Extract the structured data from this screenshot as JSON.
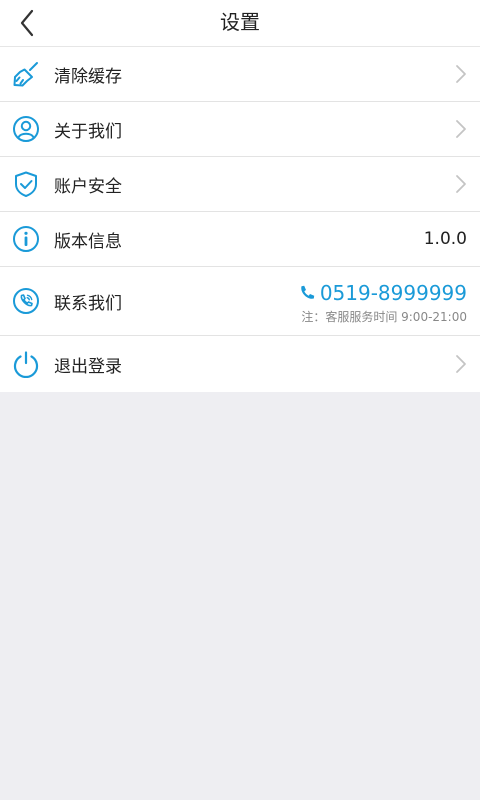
{
  "header": {
    "title": "设置",
    "back_icon": "chevron-left-icon"
  },
  "settings": {
    "clear_cache": {
      "label": "清除缓存",
      "icon": "broom-icon"
    },
    "about_us": {
      "label": "关于我们",
      "icon": "user-icon"
    },
    "account_security": {
      "label": "账户安全",
      "icon": "shield-check-icon"
    },
    "version_info": {
      "label": "版本信息",
      "icon": "info-icon",
      "value": "1.0.0"
    },
    "contact_us": {
      "label": "联系我们",
      "icon": "phone-circle-icon",
      "phone": "0519-8999999",
      "note": "注：客服服务时间 9:00-21:00"
    },
    "logout": {
      "label": "退出登录",
      "icon": "power-icon"
    }
  },
  "colors": {
    "accent": "#1a9ad8",
    "background": "#eeeef2",
    "chevron": "#c4c4c4"
  }
}
